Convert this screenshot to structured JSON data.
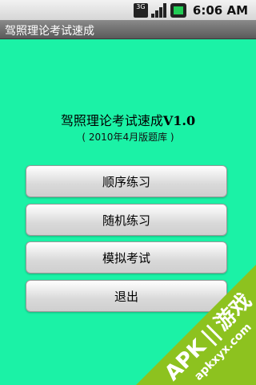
{
  "status_bar": {
    "network_label": "3G",
    "time": "6:06 AM",
    "icons": [
      "3g-icon",
      "signal-icon",
      "battery-icon"
    ]
  },
  "title_bar": {
    "title": "驾照理论考试速成"
  },
  "main": {
    "heading": "驾照理论考试速成",
    "version": "V1.0",
    "subtitle": "( 2010年4月版题库 )",
    "buttons": [
      {
        "label": "顺序练习"
      },
      {
        "label": "随机练习"
      },
      {
        "label": "模拟考试"
      },
      {
        "label": "退出"
      }
    ]
  },
  "watermark": {
    "brand": "APK",
    "brand_cn": "游戏",
    "url": "apkxyx.com"
  },
  "colors": {
    "background": "#1BF2A6",
    "watermark": "#8DC21F"
  }
}
